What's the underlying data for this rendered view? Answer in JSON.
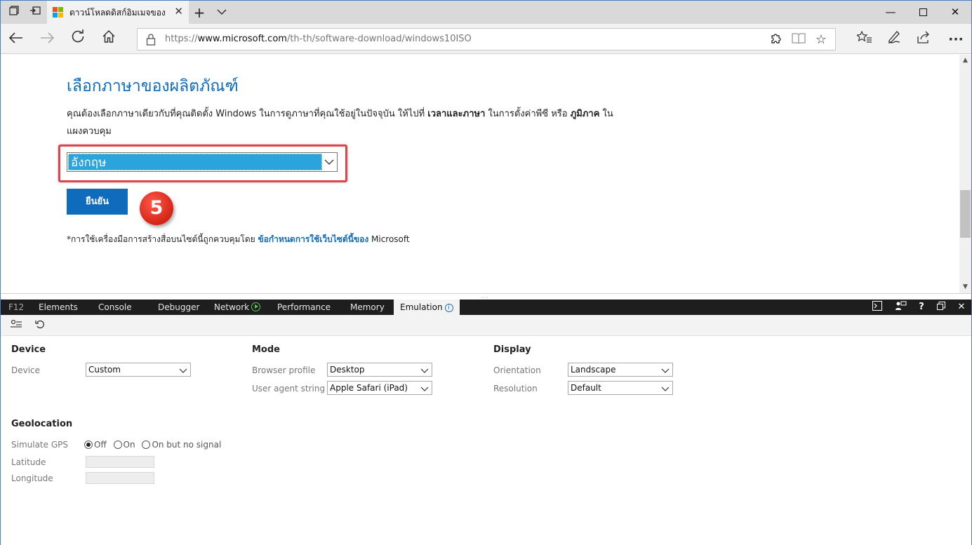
{
  "browser": {
    "tab_title": "ดาวน์โหลดดิสก์อิมเมจของ Wi",
    "url_prefix": "https://",
    "url_host": "www.microsoft.com",
    "url_path": "/th-th/software-download/windows10ISO"
  },
  "page": {
    "heading": "เลือกภาษาของผลิตภัณฑ์",
    "desc_part1": "คุณต้องเลือกภาษาเดียวกับที่คุณติดตั้ง Windows ในการดูภาษาที่คุณใช้อยู่ในปัจจุบัน ให้ไปที่ ",
    "desc_bold1": "เวลาและภาษา",
    "desc_part2": " ในการตั้งค่าพีซี หรือ ",
    "desc_bold2": "ภูมิภาค",
    "desc_part3": " ในแผงควบคุม",
    "selected_language": "อังกฤษ",
    "confirm_label": "ยืนยัน",
    "step_number": "5",
    "footnote_text": "*การใช้เครื่องมือการสร้างสื่อบนไซต์นี้ถูกควบคุมโดย ",
    "footnote_link": "ข้อกำหนดการใช้เว็บไซต์นี้ของ",
    "footnote_tail": " Microsoft"
  },
  "devtools": {
    "tabs": [
      "F12",
      "Elements",
      "Console",
      "Debugger",
      "Network",
      "Performance",
      "Memory",
      "Emulation"
    ],
    "active_tab": "Emulation",
    "device": {
      "title": "Device",
      "device_label": "Device",
      "device_value": "Custom"
    },
    "mode": {
      "title": "Mode",
      "browser_profile_label": "Browser profile",
      "browser_profile_value": "Desktop",
      "user_agent_label": "User agent string",
      "user_agent_value": "Apple Safari (iPad)"
    },
    "display": {
      "title": "Display",
      "orientation_label": "Orientation",
      "orientation_value": "Landscape",
      "resolution_label": "Resolution",
      "resolution_value": "Default"
    },
    "geolocation": {
      "title": "Geolocation",
      "simulate_label": "Simulate GPS",
      "options": [
        "Off",
        "On",
        "On but no signal"
      ],
      "selected": "Off",
      "latitude_label": "Latitude",
      "longitude_label": "Longitude"
    }
  },
  "colors": {
    "accent": "#0f6cbd",
    "selection": "#2ba3dc",
    "highlight_border": "#e0434a",
    "badge": "#d42416"
  }
}
